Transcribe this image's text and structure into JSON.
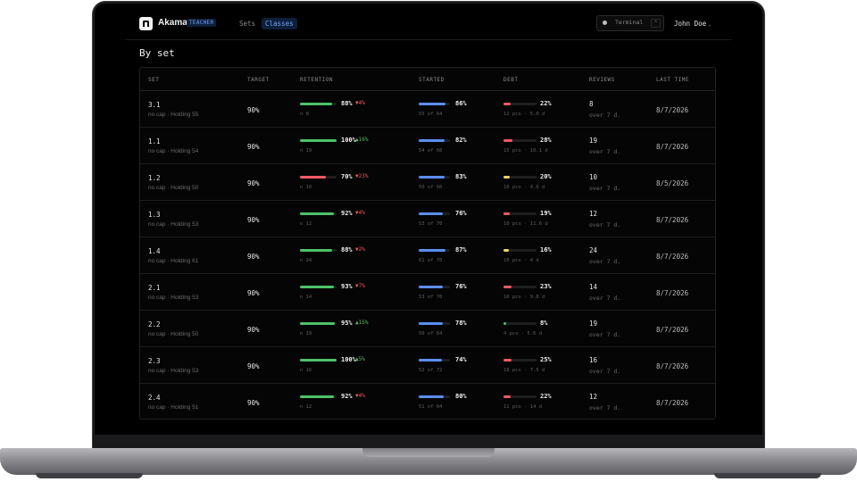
{
  "app": {
    "brand": "Akama",
    "role_badge": "TEACHER",
    "nav": [
      {
        "label": "Sets",
        "active": false
      },
      {
        "label": "Classes",
        "active": true
      }
    ],
    "theme_toggle": {
      "label": "Terminal",
      "key": "⌃"
    },
    "user": {
      "name": "John Doe",
      "chevron": "⌄"
    }
  },
  "page": {
    "title": "By set"
  },
  "table": {
    "headers": {
      "set": "SET",
      "target": "TARGET",
      "retention": "RETENTION",
      "started": "STARTED",
      "debt": "DEBT",
      "reviews": "REVIEWS",
      "last_time": "LAST TIME"
    },
    "rows": [
      {
        "set": "3.1",
        "holding": "no cap · Holding 55",
        "target": "90%",
        "retention": {
          "value": "88%",
          "delta": "▼4%",
          "dir": "down",
          "n": "n 8",
          "level": 0.88
        },
        "started": {
          "value": "86%",
          "sub": "55 of 64",
          "level": 0.86
        },
        "debt": {
          "value": "22%",
          "sub": "12 pcs · 5.0 d",
          "level": 0.22,
          "color": "#f05a64"
        },
        "reviews": {
          "count": "8",
          "sub": "over 7 d."
        },
        "last_time": "8/7/2026"
      },
      {
        "set": "1.1",
        "holding": "no cap · Holding 54",
        "target": "90%",
        "retention": {
          "value": "100%",
          "delta": "▲16%",
          "dir": "up",
          "n": "n 19",
          "level": 1.0
        },
        "started": {
          "value": "82%",
          "sub": "54 of 66",
          "level": 0.82
        },
        "debt": {
          "value": "28%",
          "sub": "15 pcs · 10.1 d",
          "level": 0.28,
          "color": "#f05a64"
        },
        "reviews": {
          "count": "19",
          "sub": "over 7 d."
        },
        "last_time": "8/7/2026"
      },
      {
        "set": "1.2",
        "holding": "no cap · Holding 50",
        "target": "90%",
        "retention": {
          "value": "70%",
          "delta": "▼23%",
          "dir": "down",
          "n": "n 10",
          "level": 0.7
        },
        "started": {
          "value": "83%",
          "sub": "50 of 60",
          "level": 0.83
        },
        "debt": {
          "value": "20%",
          "sub": "10 pcs · 4.6 d",
          "level": 0.2,
          "color": "#e9d36a"
        },
        "reviews": {
          "count": "10",
          "sub": "over 7 d."
        },
        "last_time": "8/5/2026"
      },
      {
        "set": "1.3",
        "holding": "no cap · Holding 53",
        "target": "90%",
        "retention": {
          "value": "92%",
          "delta": "▼4%",
          "dir": "down",
          "n": "n 12",
          "level": 0.92
        },
        "started": {
          "value": "76%",
          "sub": "53 of 70",
          "level": 0.76
        },
        "debt": {
          "value": "19%",
          "sub": "10 pcs · 11.6 d",
          "level": 0.19,
          "color": "#f05a64"
        },
        "reviews": {
          "count": "12",
          "sub": "over 7 d."
        },
        "last_time": "8/7/2026"
      },
      {
        "set": "1.4",
        "holding": "no cap · Holding 61",
        "target": "90%",
        "retention": {
          "value": "88%",
          "delta": "▼2%",
          "dir": "down",
          "n": "n 24",
          "level": 0.88
        },
        "started": {
          "value": "87%",
          "sub": "61 of 70",
          "level": 0.87
        },
        "debt": {
          "value": "16%",
          "sub": "10 pcs · 4 d",
          "level": 0.16,
          "color": "#e9d36a"
        },
        "reviews": {
          "count": "24",
          "sub": "over 7 d."
        },
        "last_time": "8/7/2026"
      },
      {
        "set": "2.1",
        "holding": "no cap · Holding 53",
        "target": "90%",
        "retention": {
          "value": "93%",
          "delta": "▼7%",
          "dir": "down",
          "n": "n 14",
          "level": 0.93
        },
        "started": {
          "value": "76%",
          "sub": "53 of 70",
          "level": 0.76
        },
        "debt": {
          "value": "23%",
          "sub": "16 pcs · 9.8 d",
          "level": 0.23,
          "color": "#f05a64"
        },
        "reviews": {
          "count": "14",
          "sub": "over 7 d."
        },
        "last_time": "8/7/2026"
      },
      {
        "set": "2.2",
        "holding": "no cap · Holding 50",
        "target": "90%",
        "retention": {
          "value": "95%",
          "delta": "▲15%",
          "dir": "up",
          "n": "n 19",
          "level": 0.95
        },
        "started": {
          "value": "78%",
          "sub": "50 of 64",
          "level": 0.78
        },
        "debt": {
          "value": "8%",
          "sub": "4 pcs · 5.6 d",
          "level": 0.08,
          "color": "#4ec26a"
        },
        "reviews": {
          "count": "19",
          "sub": "over 7 d."
        },
        "last_time": "8/7/2026"
      },
      {
        "set": "2.3",
        "holding": "no cap · Holding 53",
        "target": "90%",
        "retention": {
          "value": "100%",
          "delta": "▲5%",
          "dir": "up",
          "n": "n 16",
          "level": 1.0
        },
        "started": {
          "value": "74%",
          "sub": "53 of 72",
          "level": 0.74
        },
        "debt": {
          "value": "25%",
          "sub": "18 pcs · 7.5 d",
          "level": 0.25,
          "color": "#f05a64"
        },
        "reviews": {
          "count": "16",
          "sub": "over 7 d."
        },
        "last_time": "8/7/2026"
      },
      {
        "set": "2.4",
        "holding": "no cap · Holding 51",
        "target": "90%",
        "retention": {
          "value": "92%",
          "delta": "▼4%",
          "dir": "down",
          "n": "n 12",
          "level": 0.92
        },
        "started": {
          "value": "80%",
          "sub": "51 of 64",
          "level": 0.8
        },
        "debt": {
          "value": "22%",
          "sub": "11 pcs · 14 d",
          "level": 0.22,
          "color": "#f05a64"
        },
        "reviews": {
          "count": "12",
          "sub": "over 7 d."
        },
        "last_time": "8/7/2026"
      }
    ]
  },
  "colors": {
    "retention_good": "#4ec26a",
    "retention_bad": "#f05a64",
    "started": "#5b8ff0",
    "accent": "#6ea2ff"
  }
}
